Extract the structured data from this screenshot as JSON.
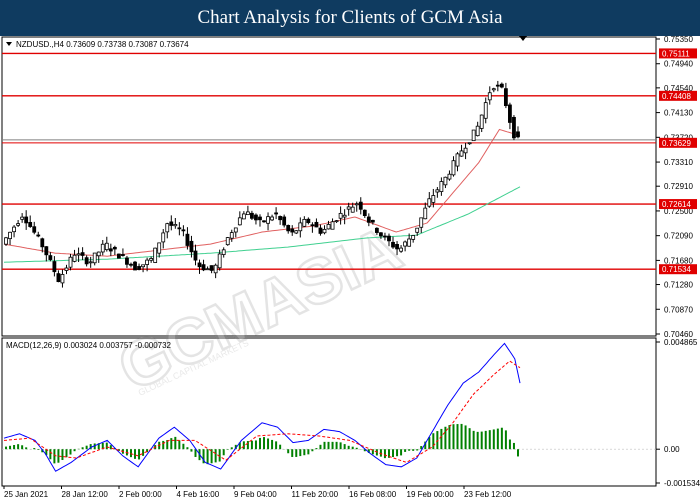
{
  "banner": {
    "title": "Chart Analysis for Clients of GCM Asia"
  },
  "watermark": {
    "main": "GCMASIA",
    "sub": "GLOBAL CAPITAL MARKETS"
  },
  "colors": {
    "banner_bg": "#0f3b60",
    "level_line": "#e00000",
    "level_label_bg": "#e00000",
    "current_label_bg": "#e00000",
    "bull_candle": "#ffffff",
    "bear_candle": "#000000",
    "ma_fast": "#e06060",
    "ma_slow": "#40d090",
    "macd_line": "#0000ff",
    "signal_line": "#ff0000",
    "histogram": "#008000"
  },
  "chart_data": [
    {
      "type": "candlestick",
      "title": "NZDUSD.,H4  0.73609 0.73738 0.73087 0.73674",
      "ylim": [
        0.7046,
        0.7535
      ],
      "y_ticks": [
        "0.75350",
        "0.74940",
        "0.74540",
        "0.74130",
        "0.73720",
        "0.73310",
        "0.72910",
        "0.72500",
        "0.72090",
        "0.71680",
        "0.71280",
        "0.70870",
        "0.70460"
      ],
      "x_ticks": [
        "25 Jan 2021",
        "28 Jan 12:00",
        "2 Feb 00:00",
        "4 Feb 16:00",
        "9 Feb 04:00",
        "11 Feb 20:00",
        "16 Feb 08:00",
        "19 Feb 00:00",
        "23 Feb 12:00"
      ],
      "levels": [
        "0.75111",
        "0.74408",
        "0.72614",
        "0.71534"
      ],
      "current_price": "0.73629",
      "series": [
        {
          "name": "NZDUSD.,H4",
          "kind": "ohlc",
          "waypoints": [
            [
              0,
              0.7195
            ],
            [
              4,
              0.7245
            ],
            [
              8,
              0.719
            ],
            [
              11,
              0.7135
            ],
            [
              14,
              0.718
            ],
            [
              17,
              0.7165
            ],
            [
              20,
              0.7195
            ],
            [
              23,
              0.7175
            ],
            [
              26,
              0.7155
            ],
            [
              29,
              0.717
            ],
            [
              32,
              0.723
            ],
            [
              35,
              0.7215
            ],
            [
              38,
              0.716
            ],
            [
              41,
              0.715
            ],
            [
              44,
              0.721
            ],
            [
              47,
              0.725
            ],
            [
              50,
              0.723
            ],
            [
              53,
              0.7245
            ],
            [
              56,
              0.721
            ],
            [
              59,
              0.7235
            ],
            [
              62,
              0.7215
            ],
            [
              65,
              0.724
            ],
            [
              69,
              0.7265
            ],
            [
              71,
              0.7235
            ],
            [
              74,
              0.7205
            ],
            [
              77,
              0.7185
            ],
            [
              80,
              0.7215
            ],
            [
              83,
              0.727
            ],
            [
              86,
              0.7305
            ],
            [
              89,
              0.735
            ],
            [
              92,
              0.7385
            ],
            [
              95,
              0.746
            ],
            [
              97,
              0.745
            ],
            [
              99,
              0.738
            ],
            [
              100,
              0.7367
            ]
          ]
        },
        {
          "name": "MA fast",
          "kind": "line",
          "waypoints": [
            [
              0,
              0.7195
            ],
            [
              10,
              0.718
            ],
            [
              20,
              0.7175
            ],
            [
              30,
              0.7185
            ],
            [
              40,
              0.7195
            ],
            [
              50,
              0.7215
            ],
            [
              60,
              0.7225
            ],
            [
              68,
              0.724
            ],
            [
              76,
              0.7215
            ],
            [
              82,
              0.723
            ],
            [
              88,
              0.729
            ],
            [
              92,
              0.733
            ],
            [
              96,
              0.7385
            ],
            [
              100,
              0.7375
            ]
          ]
        },
        {
          "name": "MA slow",
          "kind": "line",
          "waypoints": [
            [
              0,
              0.7165
            ],
            [
              20,
              0.717
            ],
            [
              40,
              0.718
            ],
            [
              55,
              0.719
            ],
            [
              70,
              0.7205
            ],
            [
              80,
              0.721
            ],
            [
              90,
              0.7245
            ],
            [
              100,
              0.729
            ]
          ]
        }
      ]
    },
    {
      "type": "line",
      "title": "MACD(12,26,9) 0.003024 0.003757 -0.000732",
      "ylim": [
        -0.001534,
        0.004865
      ],
      "y_ticks": [
        "0.004865",
        "0.00",
        "-0.001534"
      ],
      "series": [
        {
          "name": "MACD",
          "kind": "line",
          "waypoints": [
            [
              0,
              0.0005
            ],
            [
              3,
              0.0007
            ],
            [
              6,
              0.0004
            ],
            [
              8,
              -0.0002
            ],
            [
              10,
              -0.001
            ],
            [
              13,
              -0.0006
            ],
            [
              17,
              0.0001
            ],
            [
              20,
              0.0004
            ],
            [
              23,
              -0.0003
            ],
            [
              26,
              -0.0008
            ],
            [
              30,
              0.0005
            ],
            [
              33,
              0.001
            ],
            [
              36,
              0.0004
            ],
            [
              39,
              -0.0006
            ],
            [
              42,
              -0.0009
            ],
            [
              46,
              0.0004
            ],
            [
              50,
              0.0012
            ],
            [
              53,
              0.001
            ],
            [
              56,
              0.0003
            ],
            [
              59,
              0.0004
            ],
            [
              62,
              0.0009
            ],
            [
              65,
              0.0008
            ],
            [
              68,
              0.0004
            ],
            [
              71,
              -0.0002
            ],
            [
              74,
              -0.0007
            ],
            [
              77,
              -0.0008
            ],
            [
              80,
              -0.0004
            ],
            [
              83,
              0.0008
            ],
            [
              86,
              0.002
            ],
            [
              89,
              0.003
            ],
            [
              92,
              0.0035
            ],
            [
              95,
              0.0043
            ],
            [
              97,
              0.0048
            ],
            [
              99,
              0.0041
            ],
            [
              100,
              0.003
            ]
          ]
        },
        {
          "name": "Signal",
          "kind": "line",
          "waypoints": [
            [
              0,
              0.0004
            ],
            [
              5,
              0.0005
            ],
            [
              10,
              -0.0003
            ],
            [
              14,
              -0.0004
            ],
            [
              20,
              0.0001
            ],
            [
              26,
              -0.0003
            ],
            [
              32,
              0.0004
            ],
            [
              37,
              0.0004
            ],
            [
              43,
              -0.0005
            ],
            [
              49,
              0.0006
            ],
            [
              55,
              0.0007
            ],
            [
              61,
              0.0006
            ],
            [
              67,
              0.0004
            ],
            [
              73,
              -0.0002
            ],
            [
              78,
              -0.0006
            ],
            [
              83,
              0.0001
            ],
            [
              87,
              0.0012
            ],
            [
              91,
              0.0025
            ],
            [
              95,
              0.0034
            ],
            [
              98,
              0.004
            ],
            [
              100,
              0.0037
            ]
          ]
        },
        {
          "name": "Histogram",
          "kind": "bars",
          "ref_series": "MACD",
          "ref_minus": "Signal"
        }
      ]
    }
  ]
}
